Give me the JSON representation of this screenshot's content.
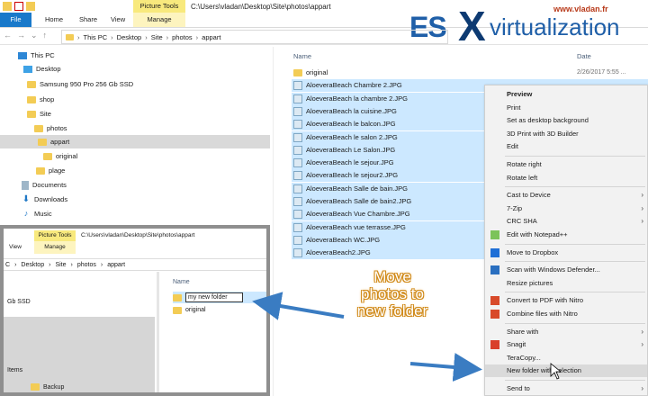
{
  "ribbon": {
    "tabs": [
      "File",
      "Home",
      "Share",
      "View",
      "Manage"
    ],
    "picture_tools": "Picture Tools",
    "title_path": "C:\\Users\\vladan\\Desktop\\Site\\photos\\appart"
  },
  "address": {
    "crumbs": [
      "This PC",
      "Desktop",
      "Site",
      "photos",
      "appart"
    ]
  },
  "logo": {
    "es": "ES",
    "x": "X",
    "rest": "virtualization",
    "url": "www.vladan.fr"
  },
  "tree": [
    {
      "label": "This PC",
      "icon": "pc-icon"
    },
    {
      "label": "Desktop",
      "icon": "desktop-icon"
    },
    {
      "label": "Samsung 950 Pro 256 Gb SSD",
      "icon": "folder-icon"
    },
    {
      "label": "shop",
      "icon": "folder-icon"
    },
    {
      "label": "Site",
      "icon": "folder-icon"
    },
    {
      "label": "photos",
      "icon": "folder-icon"
    },
    {
      "label": "appart",
      "icon": "folder-icon",
      "selected": true
    },
    {
      "label": "original",
      "icon": "folder-icon"
    },
    {
      "label": "plage",
      "icon": "folder-icon"
    },
    {
      "label": "Documents",
      "icon": "documents-icon"
    },
    {
      "label": "Downloads",
      "icon": "downloads-icon"
    },
    {
      "label": "Music",
      "icon": "music-icon"
    }
  ],
  "list": {
    "col_name": "Name",
    "col_date": "Date",
    "rows": [
      {
        "name": "original",
        "date": "2/26/2017 5:55 ...",
        "type": "folder"
      },
      {
        "name": "AloeveraBeach Chambre 2.JPG",
        "date": "",
        "type": "image",
        "selected": true
      },
      {
        "name": "AloeveraBeach la chambre 2.JPG",
        "date": "",
        "type": "image",
        "selected": true
      },
      {
        "name": "AloeveraBeach la cuisine.JPG",
        "date": "",
        "type": "image",
        "selected": true
      },
      {
        "name": "AloeveraBeach le balcon.JPG",
        "date": "",
        "type": "image",
        "selected": true
      },
      {
        "name": "AloeveraBeach le salon 2.JPG",
        "date": "",
        "type": "image",
        "selected": true
      },
      {
        "name": "AloeveraBeach Le Salon.JPG",
        "date": "",
        "type": "image",
        "selected": true
      },
      {
        "name": "AloeveraBeach le sejour.JPG",
        "date": "",
        "type": "image",
        "selected": true
      },
      {
        "name": "AloeveraBeach le sejour2.JPG",
        "date": "",
        "type": "image",
        "selected": true
      },
      {
        "name": "AloeveraBeach Salle de bain.JPG",
        "date": "",
        "type": "image",
        "selected": true
      },
      {
        "name": "AloeveraBeach Salle de bain2.JPG",
        "date": "",
        "type": "image",
        "selected": true
      },
      {
        "name": "AloeveraBeach Vue Chambre.JPG",
        "date": "",
        "type": "image",
        "selected": true
      },
      {
        "name": "AloeveraBeach vue terrasse.JPG",
        "date": "",
        "type": "image",
        "selected": true
      },
      {
        "name": "AloeveraBeach WC.JPG",
        "date": "",
        "type": "image",
        "selected": true
      },
      {
        "name": "AloeveraBeach2.JPG",
        "date": "",
        "type": "image",
        "selected": true
      }
    ]
  },
  "context_menu": {
    "items": [
      {
        "label": "Preview",
        "bold": true
      },
      {
        "label": "Print"
      },
      {
        "label": "Set as desktop background"
      },
      {
        "label": "3D Print with 3D Builder"
      },
      {
        "label": "Edit"
      },
      {
        "sep": true
      },
      {
        "label": "Rotate right"
      },
      {
        "label": "Rotate left"
      },
      {
        "sep": true
      },
      {
        "label": "Cast to Device",
        "submenu": true
      },
      {
        "label": "7-Zip",
        "submenu": true
      },
      {
        "label": "CRC SHA",
        "submenu": true
      },
      {
        "label": "Edit with Notepad++",
        "icon": "notepad-icon"
      },
      {
        "sep": true
      },
      {
        "label": "Move to Dropbox",
        "icon": "dropbox-icon"
      },
      {
        "sep": true
      },
      {
        "label": "Scan with Windows Defender...",
        "icon": "defender-icon"
      },
      {
        "label": "Resize pictures"
      },
      {
        "sep": true
      },
      {
        "label": "Convert to PDF with Nitro",
        "icon": "nitro-icon"
      },
      {
        "label": "Combine files with Nitro",
        "icon": "nitro-combine-icon"
      },
      {
        "sep": true
      },
      {
        "label": "Share with",
        "submenu": true
      },
      {
        "label": "Snagit",
        "submenu": true,
        "icon": "snagit-icon"
      },
      {
        "label": "TeraCopy..."
      },
      {
        "label": "New folder with selection",
        "highlighted": true
      },
      {
        "sep": true
      },
      {
        "label": "Send to",
        "submenu": true
      }
    ]
  },
  "inset": {
    "picture_tools": "Picture Tools",
    "title_path": "C:\\Users\\vladan\\Desktop\\Site\\photos\\appart",
    "tabs": [
      "View",
      "Manage"
    ],
    "crumbs": [
      "C",
      "Desktop",
      "Site",
      "photos",
      "appart"
    ],
    "left_items": [
      "Gb SSD",
      "Items",
      "Backup"
    ],
    "col_name": "Name",
    "rename_value": "my new folder",
    "folder2": "original"
  },
  "annotation": {
    "text": "Move photos to new folder",
    "color": "#f0a030"
  },
  "colors": {
    "selection": "#cce8ff",
    "file_tab": "#1979ca",
    "picture_tools": "#f8e97d",
    "arrow": "#3a7cc2"
  }
}
